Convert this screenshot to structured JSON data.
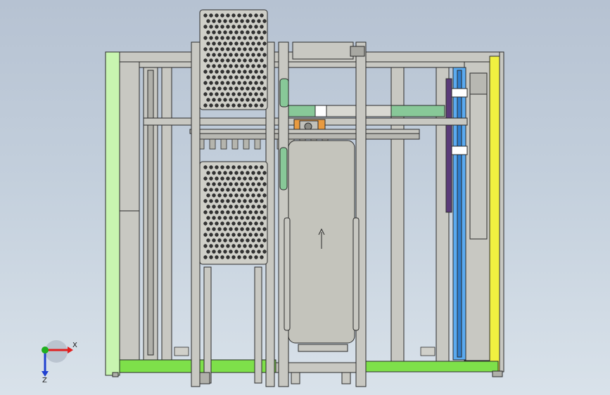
{
  "viewport": {
    "background_top": "#b6c2d2",
    "background_bottom": "#d9e2ea"
  },
  "model": {
    "frame_color": "#c8c8c2",
    "edge_color": "#2a2a2a",
    "accent_green": "#c8f5b0",
    "accent_lime": "#7ee04a",
    "accent_yellow": "#f0f040",
    "accent_blue": "#5aaaf0",
    "accent_purple": "#5a3a78",
    "accent_teal": "#88c898",
    "accent_orange": "#e89a40"
  },
  "triad": {
    "x_label": "X",
    "z_label": "Z",
    "x_color": "#e02020",
    "y_color": "#20b020",
    "z_color": "#2040d0"
  }
}
